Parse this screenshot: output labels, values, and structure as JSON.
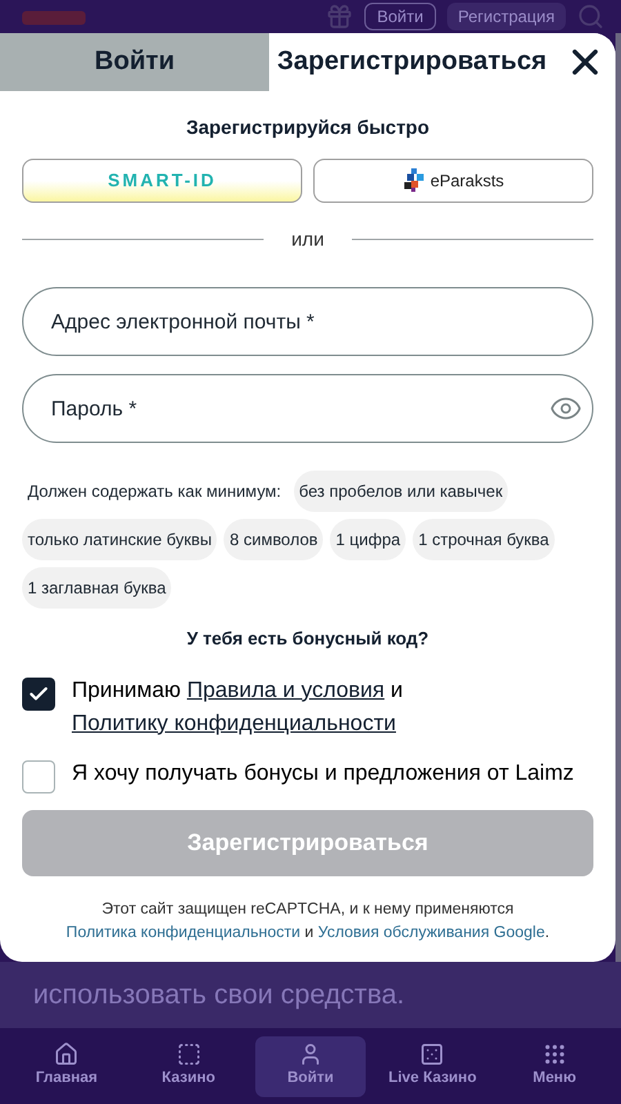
{
  "header": {
    "buttons": [
      {
        "label": "Войти",
        "kind": "outline"
      },
      {
        "label": "Регистрация",
        "kind": "filled"
      }
    ]
  },
  "modal": {
    "tabs": [
      {
        "label": "Войти",
        "selected": false
      },
      {
        "label": "Зарегистрироваться",
        "selected": true
      }
    ],
    "quick_title": "Зарегистрируйся быстро",
    "quick_buttons": [
      {
        "kind": "smartid",
        "label": "SMART-ID"
      },
      {
        "kind": "eparaksts",
        "label": "eParaksts"
      }
    ],
    "divider": "или",
    "fields": [
      {
        "kind": "email",
        "placeholder": "Адрес электронной почты *"
      },
      {
        "kind": "password",
        "placeholder": "Пароль *"
      }
    ],
    "requirements": {
      "intro": "Должен содержать как минимум:",
      "items": [
        "без пробелов или кавычек",
        "только латинские буквы",
        "8 символов",
        "1 цифра",
        "1 строчная буква",
        "1 заглавная буква"
      ]
    },
    "bonus_code": "У тебя есть бонусный код?",
    "consents": [
      {
        "checked": true,
        "segments": [
          {
            "text": "Принимаю ",
            "link": false
          },
          {
            "text": "Правила и условия",
            "link": true
          },
          {
            "text": " и ",
            "link": false
          },
          {
            "text": "Политику конфиденциальности",
            "link": true
          }
        ]
      },
      {
        "checked": false,
        "segments": [
          {
            "text": "Я хочу получать бонусы и предложения от Laimz",
            "link": false
          }
        ]
      }
    ],
    "submit": {
      "label": "Зарегистрироваться",
      "disabled": true
    },
    "recaptcha": [
      {
        "text": "Этот сайт защищен reCAPTCHA, и к нему применяются ",
        "link": false
      },
      {
        "text": "Политика конфиденциальности",
        "link": true
      },
      {
        "text": " и ",
        "link": false
      },
      {
        "text": "Условия обслуживания Google",
        "link": true
      },
      {
        "text": ".",
        "link": false
      }
    ]
  },
  "page_text": "использовать свои средства.",
  "bottom_nav": [
    {
      "label": "Главная",
      "kind": "home",
      "selected": false
    },
    {
      "label": "Казино",
      "kind": "casino",
      "selected": false
    },
    {
      "label": "Войти",
      "kind": "user",
      "selected": true
    },
    {
      "label": "Live Казино",
      "kind": "wheel",
      "selected": false
    },
    {
      "label": "Меню",
      "kind": "grid",
      "selected": false
    }
  ]
}
